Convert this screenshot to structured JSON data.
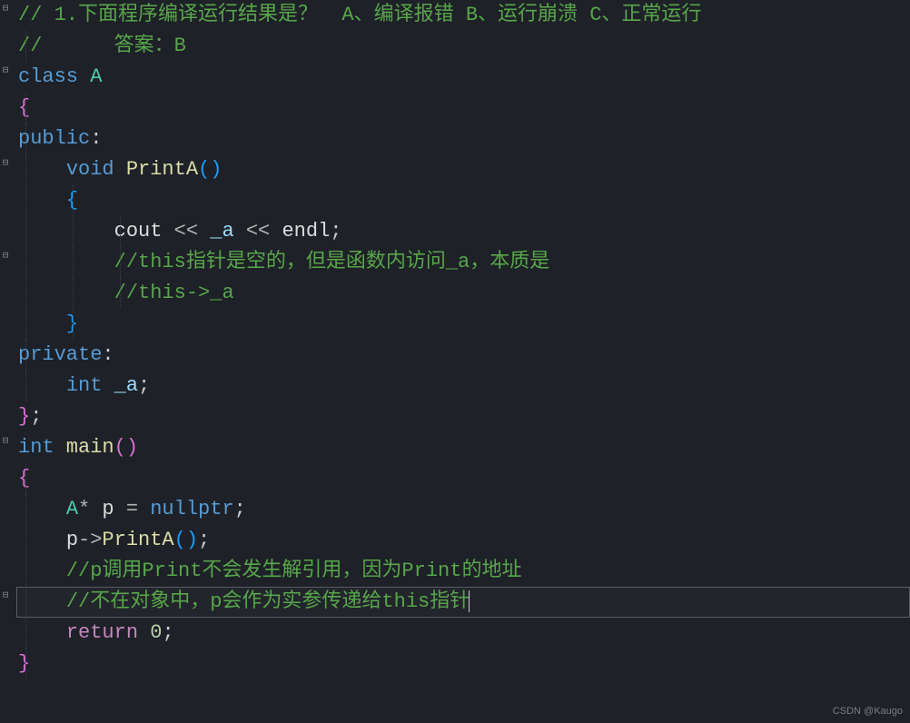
{
  "gutter": {
    "fold_markers": [
      "⊟",
      "⊟",
      "⊟",
      "⊟",
      "⊟",
      "⊟"
    ]
  },
  "code": {
    "l1": {
      "comment": "// 1.下面程序编译运行结果是？  A、编译报错 B、运行崩溃 C、正常运行"
    },
    "l2": {
      "comment": "//      答案：B"
    },
    "l3": {
      "kw_class": "class",
      "type_A": " A"
    },
    "l4": {
      "brace": "{"
    },
    "l5": {
      "kw_public": "public",
      "colon": ":"
    },
    "l6": {
      "kw_void": "void",
      "fn": " PrintA",
      "paren": "()"
    },
    "l7": {
      "brace": "{"
    },
    "l8": {
      "cout": "cout ",
      "op1": "<<",
      "a": " _a ",
      "op2": "<<",
      "endl": " endl",
      "semi": ";"
    },
    "l9": {
      "comment": "//this指针是空的，但是函数内访问_a，本质是"
    },
    "l10": {
      "comment": "//this->_a"
    },
    "l11": {
      "brace": "}"
    },
    "l12": {
      "kw_private": "private",
      "colon": ":"
    },
    "l13": {
      "kw_int": "int",
      "a": " _a",
      "semi": ";"
    },
    "l14": {
      "brace": "}",
      "semi": ";"
    },
    "l15": {
      "kw_int": "int",
      "fn": " main",
      "paren": "()"
    },
    "l16": {
      "brace": "{"
    },
    "l17": {
      "type_A": "A",
      "star": "* ",
      "p": "p ",
      "eq": "= ",
      "null": "nullptr",
      "semi": ";"
    },
    "l18": {
      "p": "p",
      "arrow": "->",
      "fn": "PrintA",
      "paren": "()",
      "semi": ";"
    },
    "l19": {
      "comment": "//p调用Print不会发生解引用，因为Print的地址"
    },
    "l20": {
      "comment": "//不在对象中，p会作为实参传递给this指针"
    },
    "l21": {
      "kw_return": "return ",
      "num": "0",
      "semi": ";"
    },
    "l22": {
      "brace": "}"
    }
  },
  "watermark": "CSDN @Kaugo"
}
